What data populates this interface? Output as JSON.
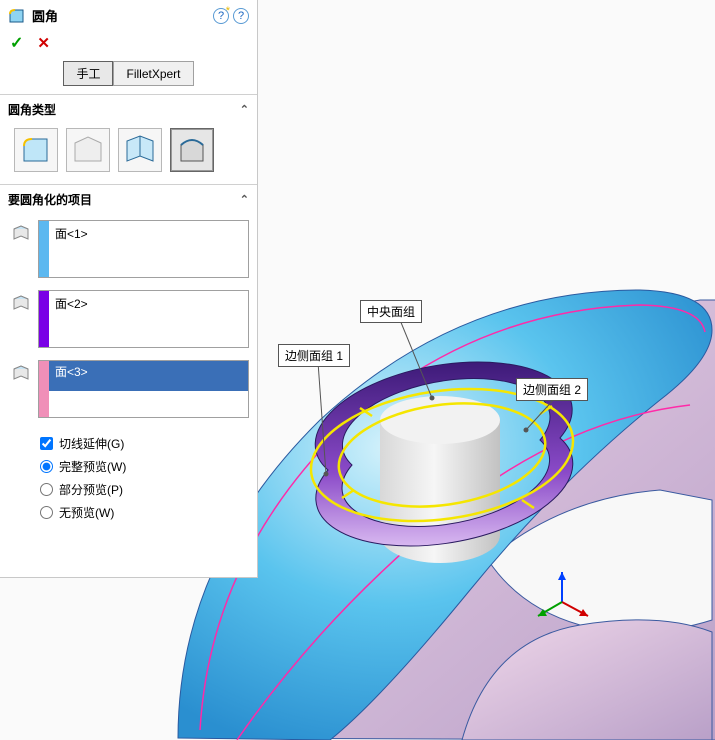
{
  "header": {
    "title": "圆角",
    "help1": "?",
    "help2": "?"
  },
  "tabs": {
    "manual": "手工",
    "xpert": "FilletXpert"
  },
  "sections": {
    "type": "圆角类型",
    "items": "要圆角化的项目"
  },
  "faces": {
    "f1": "面<1>",
    "f2": "面<2>",
    "f3": "面<3>"
  },
  "options": {
    "tangent": "切线延伸(G)",
    "full": "完整预览(W)",
    "partial": "部分预览(P)",
    "none": "无预览(W)"
  },
  "callouts": {
    "side1": "边侧面组 1",
    "center": "中央面组",
    "side2": "边侧面组 2"
  },
  "colors": {
    "stripe1": "#5bb8f0",
    "stripe2": "#7a00e6",
    "stripe3": "#f08fb8"
  }
}
